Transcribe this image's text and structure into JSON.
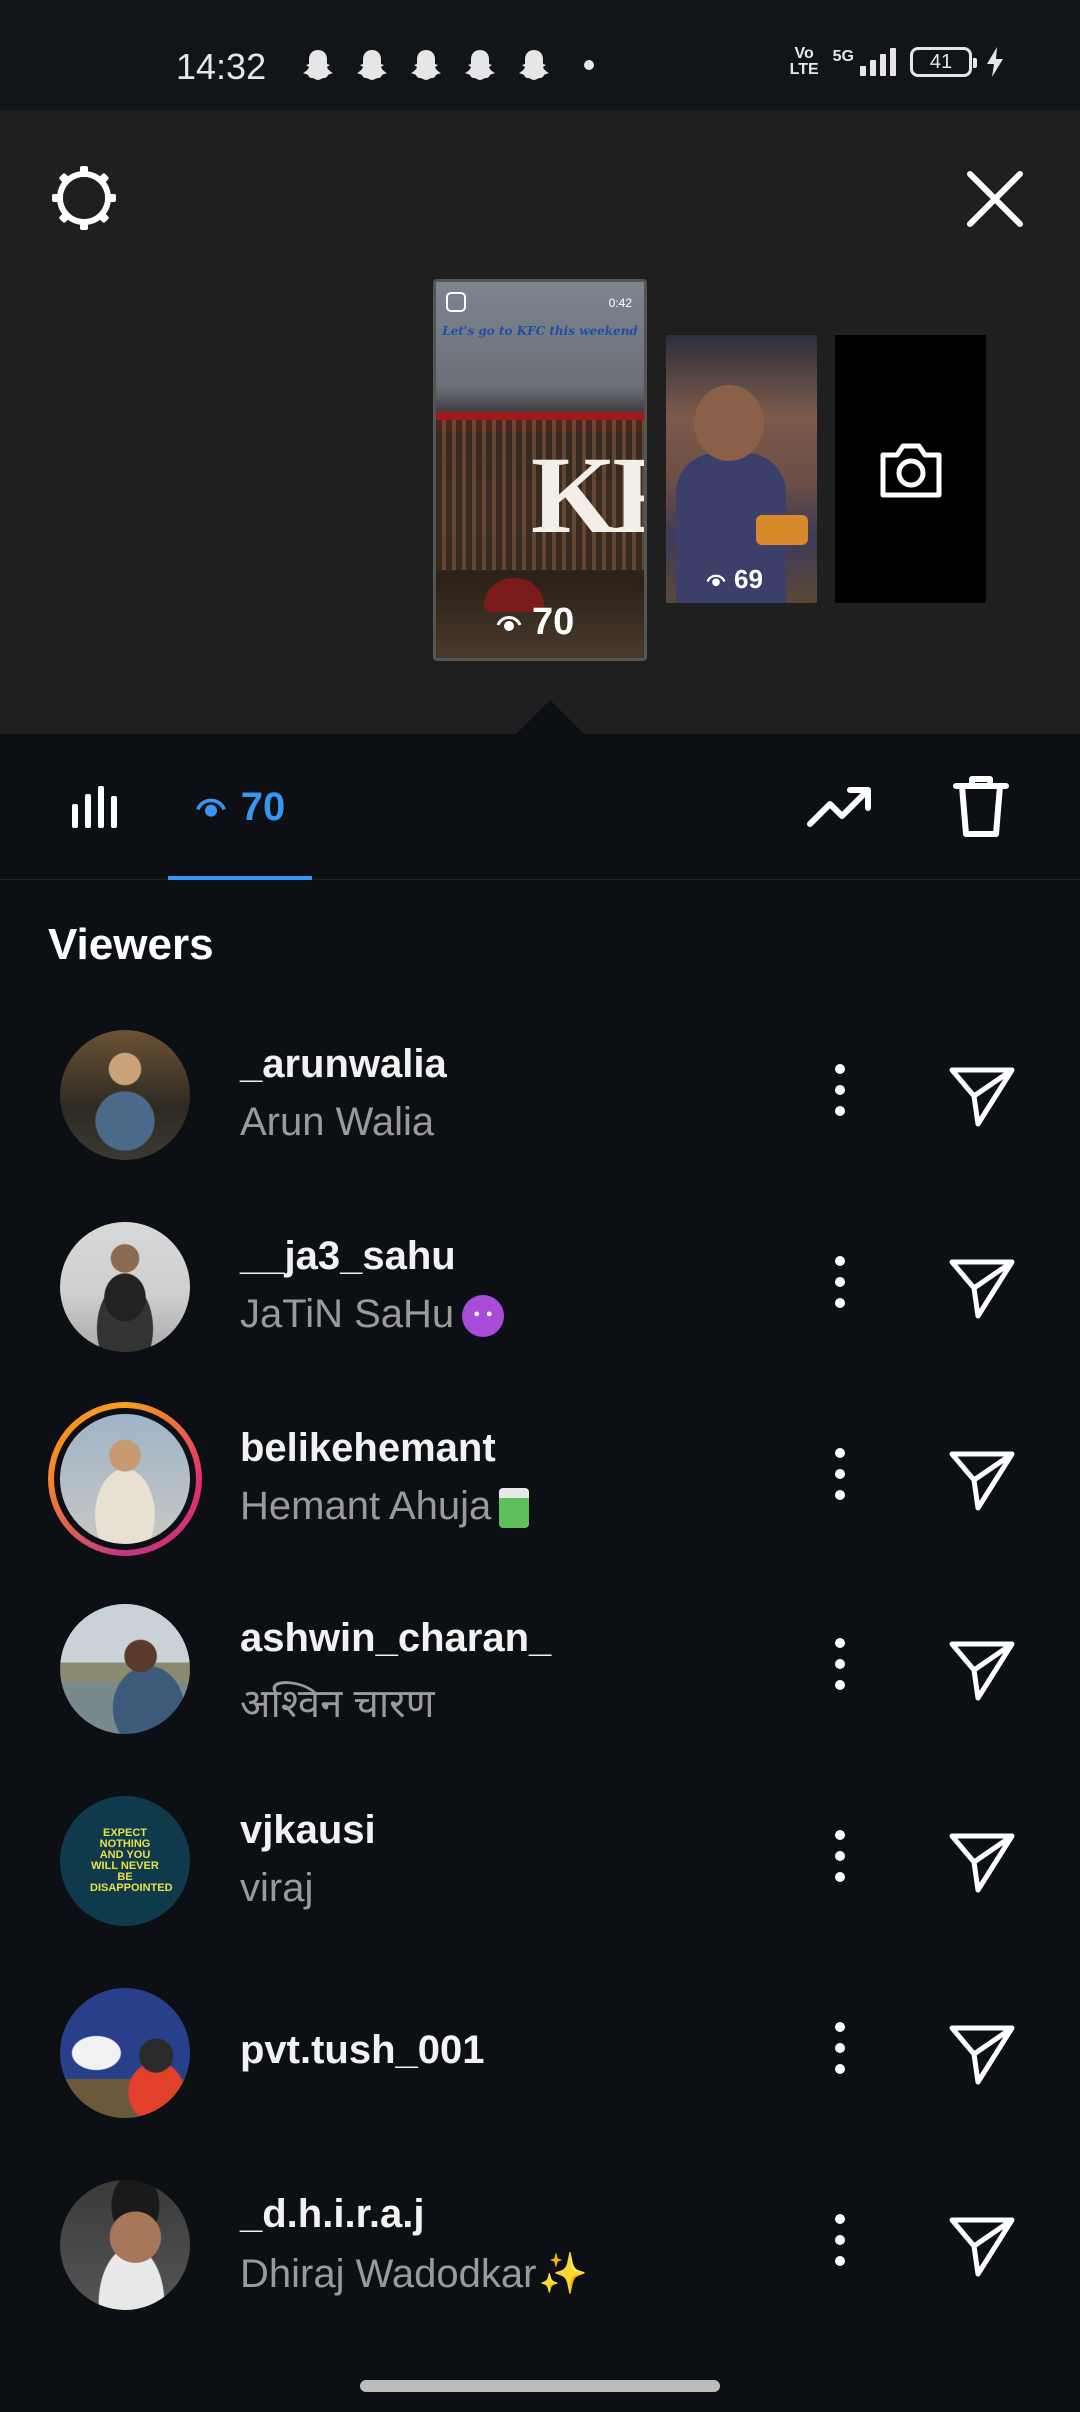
{
  "status_bar": {
    "time": "14:32",
    "notification_icons": [
      "snapchat-icon",
      "snapchat-icon",
      "snapchat-icon",
      "snapchat-icon",
      "snapchat-icon"
    ],
    "network_volte": "Vo LTE",
    "network_type": "5G",
    "battery": "41"
  },
  "stories": {
    "main": {
      "timer": "0:42",
      "caption": "Let's go to KFC this weekend",
      "sign_text": "KF",
      "view_count": "70"
    },
    "second": {
      "view_count": "69"
    }
  },
  "tabs": {
    "viewers_count": "70"
  },
  "viewers_title": "Viewers",
  "viewers": [
    {
      "username": "_arunwalia",
      "name": "Arun Walia"
    },
    {
      "username": "__ja3_sahu",
      "name": "JaTiN SaHu",
      "emoji": "smiling-devil"
    },
    {
      "username": "belikehemant",
      "name": "Hemant Ahuja",
      "emoji": "juice-box"
    },
    {
      "username": "ashwin_charan_",
      "name": "अश्विन चारण"
    },
    {
      "username": "vjkausi",
      "name": "viraj",
      "avatar_text": "EXPECT NOTHING AND YOU WILL NEVER BE DISAPPOINTED"
    },
    {
      "username": "pvt.tush_001",
      "name": ""
    },
    {
      "username": "_d.h.i.r.a.j",
      "name": "Dhiraj Wadodkar",
      "emoji": "sparkles"
    }
  ],
  "colors": {
    "accent": "#3797f0",
    "background": "#0c0f14",
    "preview_bg": "#1f1f1f"
  }
}
